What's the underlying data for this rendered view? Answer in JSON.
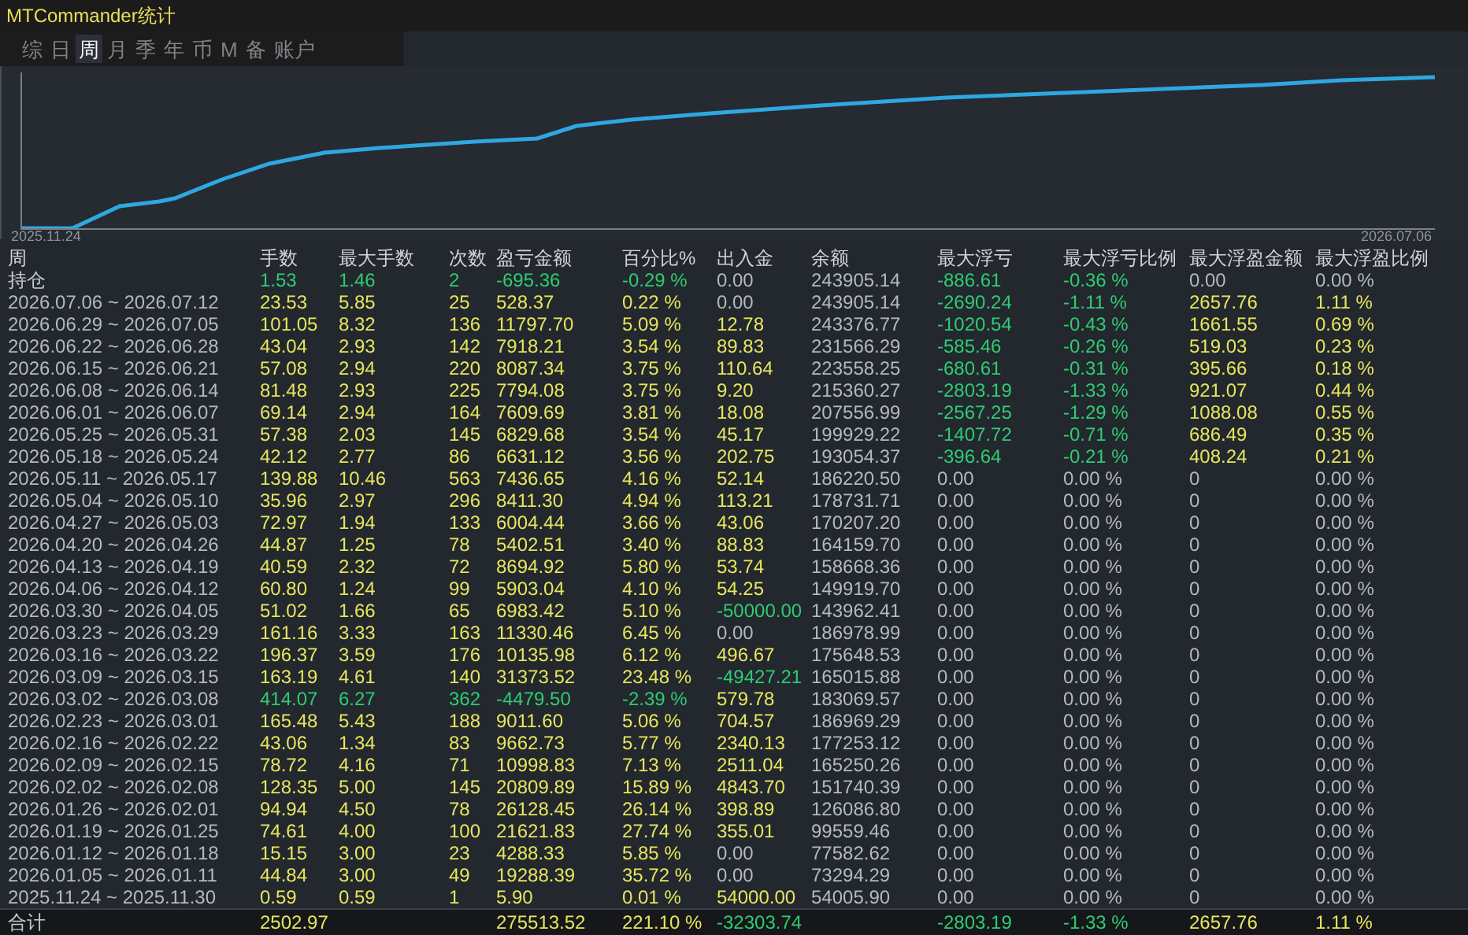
{
  "window": {
    "title": "MTCommander统计"
  },
  "tabs": [
    {
      "label": "综",
      "selected": false
    },
    {
      "label": "日",
      "selected": false
    },
    {
      "label": "周",
      "selected": true
    },
    {
      "label": "月",
      "selected": false
    },
    {
      "label": "季",
      "selected": false
    },
    {
      "label": "年",
      "selected": false
    },
    {
      "label": "币",
      "selected": false
    },
    {
      "label": "M",
      "selected": false
    },
    {
      "label": "备",
      "selected": false
    },
    {
      "label": "账户",
      "selected": false
    }
  ],
  "chart": {
    "start_label": "2025.11.24",
    "end_label": "2026.07.06"
  },
  "table": {
    "columns": [
      "周",
      "手数",
      "最大手数",
      "次数",
      "盈亏金额",
      "百分比%",
      "出入金",
      "余额",
      "最大浮亏",
      "最大浮亏比例",
      "最大浮盈金额",
      "最大浮盈比例"
    ],
    "rows": [
      [
        {
          "text": "持仓",
          "color": "#c4c8cf"
        },
        {
          "text": "1.53",
          "color": "#2ecc71"
        },
        {
          "text": "1.46",
          "color": "#2ecc71"
        },
        {
          "text": "2",
          "color": "#2ecc71"
        },
        {
          "text": "-695.36",
          "color": "#2ecc71"
        },
        {
          "text": "-0.29 %",
          "color": "#2ecc71"
        },
        {
          "text": "0.00",
          "color": "#b4b9c2"
        },
        {
          "text": "243905.14",
          "color": "#b4b9c2"
        },
        {
          "text": "-886.61",
          "color": "#2ecc71"
        },
        {
          "text": "-0.36 %",
          "color": "#2ecc71"
        },
        {
          "text": "0.00",
          "color": "#b4b9c2"
        },
        {
          "text": "0.00 %",
          "color": "#b4b9c2"
        }
      ],
      [
        {
          "text": "2026.07.06 ~ 2026.07.12",
          "color": "#b4b9c2"
        },
        {
          "text": "23.53",
          "color": "#e6e65c"
        },
        {
          "text": "5.85",
          "color": "#e6e65c"
        },
        {
          "text": "25",
          "color": "#e6e65c"
        },
        {
          "text": "528.37",
          "color": "#e6e65c"
        },
        {
          "text": "0.22 %",
          "color": "#e6e65c"
        },
        {
          "text": "0.00",
          "color": "#b4b9c2"
        },
        {
          "text": "243905.14",
          "color": "#b4b9c2"
        },
        {
          "text": "-2690.24",
          "color": "#2ecc71"
        },
        {
          "text": "-1.11 %",
          "color": "#2ecc71"
        },
        {
          "text": "2657.76",
          "color": "#e6e65c"
        },
        {
          "text": "1.11 %",
          "color": "#e6e65c"
        }
      ],
      [
        {
          "text": "2026.06.29 ~ 2026.07.05",
          "color": "#b4b9c2"
        },
        {
          "text": "101.05",
          "color": "#e6e65c"
        },
        {
          "text": "8.32",
          "color": "#e6e65c"
        },
        {
          "text": "136",
          "color": "#e6e65c"
        },
        {
          "text": "11797.70",
          "color": "#e6e65c"
        },
        {
          "text": "5.09 %",
          "color": "#e6e65c"
        },
        {
          "text": "12.78",
          "color": "#e6e65c"
        },
        {
          "text": "243376.77",
          "color": "#b4b9c2"
        },
        {
          "text": "-1020.54",
          "color": "#2ecc71"
        },
        {
          "text": "-0.43 %",
          "color": "#2ecc71"
        },
        {
          "text": "1661.55",
          "color": "#e6e65c"
        },
        {
          "text": "0.69 %",
          "color": "#e6e65c"
        }
      ],
      [
        {
          "text": "2026.06.22 ~ 2026.06.28",
          "color": "#b4b9c2"
        },
        {
          "text": "43.04",
          "color": "#e6e65c"
        },
        {
          "text": "2.93",
          "color": "#e6e65c"
        },
        {
          "text": "142",
          "color": "#e6e65c"
        },
        {
          "text": "7918.21",
          "color": "#e6e65c"
        },
        {
          "text": "3.54 %",
          "color": "#e6e65c"
        },
        {
          "text": "89.83",
          "color": "#e6e65c"
        },
        {
          "text": "231566.29",
          "color": "#b4b9c2"
        },
        {
          "text": "-585.46",
          "color": "#2ecc71"
        },
        {
          "text": "-0.26 %",
          "color": "#2ecc71"
        },
        {
          "text": "519.03",
          "color": "#e6e65c"
        },
        {
          "text": "0.23 %",
          "color": "#e6e65c"
        }
      ],
      [
        {
          "text": "2026.06.15 ~ 2026.06.21",
          "color": "#b4b9c2"
        },
        {
          "text": "57.08",
          "color": "#e6e65c"
        },
        {
          "text": "2.94",
          "color": "#e6e65c"
        },
        {
          "text": "220",
          "color": "#e6e65c"
        },
        {
          "text": "8087.34",
          "color": "#e6e65c"
        },
        {
          "text": "3.75 %",
          "color": "#e6e65c"
        },
        {
          "text": "110.64",
          "color": "#e6e65c"
        },
        {
          "text": "223558.25",
          "color": "#b4b9c2"
        },
        {
          "text": "-680.61",
          "color": "#2ecc71"
        },
        {
          "text": "-0.31 %",
          "color": "#2ecc71"
        },
        {
          "text": "395.66",
          "color": "#e6e65c"
        },
        {
          "text": "0.18 %",
          "color": "#e6e65c"
        }
      ],
      [
        {
          "text": "2026.06.08 ~ 2026.06.14",
          "color": "#b4b9c2"
        },
        {
          "text": "81.48",
          "color": "#e6e65c"
        },
        {
          "text": "2.93",
          "color": "#e6e65c"
        },
        {
          "text": "225",
          "color": "#e6e65c"
        },
        {
          "text": "7794.08",
          "color": "#e6e65c"
        },
        {
          "text": "3.75 %",
          "color": "#e6e65c"
        },
        {
          "text": "9.20",
          "color": "#e6e65c"
        },
        {
          "text": "215360.27",
          "color": "#b4b9c2"
        },
        {
          "text": "-2803.19",
          "color": "#2ecc71"
        },
        {
          "text": "-1.33 %",
          "color": "#2ecc71"
        },
        {
          "text": "921.07",
          "color": "#e6e65c"
        },
        {
          "text": "0.44 %",
          "color": "#e6e65c"
        }
      ],
      [
        {
          "text": "2026.06.01 ~ 2026.06.07",
          "color": "#b4b9c2"
        },
        {
          "text": "69.14",
          "color": "#e6e65c"
        },
        {
          "text": "2.94",
          "color": "#e6e65c"
        },
        {
          "text": "164",
          "color": "#e6e65c"
        },
        {
          "text": "7609.69",
          "color": "#e6e65c"
        },
        {
          "text": "3.81 %",
          "color": "#e6e65c"
        },
        {
          "text": "18.08",
          "color": "#e6e65c"
        },
        {
          "text": "207556.99",
          "color": "#b4b9c2"
        },
        {
          "text": "-2567.25",
          "color": "#2ecc71"
        },
        {
          "text": "-1.29 %",
          "color": "#2ecc71"
        },
        {
          "text": "1088.08",
          "color": "#e6e65c"
        },
        {
          "text": "0.55 %",
          "color": "#e6e65c"
        }
      ],
      [
        {
          "text": "2026.05.25 ~ 2026.05.31",
          "color": "#b4b9c2"
        },
        {
          "text": "57.38",
          "color": "#e6e65c"
        },
        {
          "text": "2.03",
          "color": "#e6e65c"
        },
        {
          "text": "145",
          "color": "#e6e65c"
        },
        {
          "text": "6829.68",
          "color": "#e6e65c"
        },
        {
          "text": "3.54 %",
          "color": "#e6e65c"
        },
        {
          "text": "45.17",
          "color": "#e6e65c"
        },
        {
          "text": "199929.22",
          "color": "#b4b9c2"
        },
        {
          "text": "-1407.72",
          "color": "#2ecc71"
        },
        {
          "text": "-0.71 %",
          "color": "#2ecc71"
        },
        {
          "text": "686.49",
          "color": "#e6e65c"
        },
        {
          "text": "0.35 %",
          "color": "#e6e65c"
        }
      ],
      [
        {
          "text": "2026.05.18 ~ 2026.05.24",
          "color": "#b4b9c2"
        },
        {
          "text": "42.12",
          "color": "#e6e65c"
        },
        {
          "text": "2.77",
          "color": "#e6e65c"
        },
        {
          "text": "86",
          "color": "#e6e65c"
        },
        {
          "text": "6631.12",
          "color": "#e6e65c"
        },
        {
          "text": "3.56 %",
          "color": "#e6e65c"
        },
        {
          "text": "202.75",
          "color": "#e6e65c"
        },
        {
          "text": "193054.37",
          "color": "#b4b9c2"
        },
        {
          "text": "-396.64",
          "color": "#2ecc71"
        },
        {
          "text": "-0.21 %",
          "color": "#2ecc71"
        },
        {
          "text": "408.24",
          "color": "#e6e65c"
        },
        {
          "text": "0.21 %",
          "color": "#e6e65c"
        }
      ],
      [
        {
          "text": "2026.05.11 ~ 2026.05.17",
          "color": "#b4b9c2"
        },
        {
          "text": "139.88",
          "color": "#e6e65c"
        },
        {
          "text": "10.46",
          "color": "#e6e65c"
        },
        {
          "text": "563",
          "color": "#e6e65c"
        },
        {
          "text": "7436.65",
          "color": "#e6e65c"
        },
        {
          "text": "4.16 %",
          "color": "#e6e65c"
        },
        {
          "text": "52.14",
          "color": "#e6e65c"
        },
        {
          "text": "186220.50",
          "color": "#b4b9c2"
        },
        {
          "text": "0.00",
          "color": "#b4b9c2"
        },
        {
          "text": "0.00 %",
          "color": "#b4b9c2"
        },
        {
          "text": "0",
          "color": "#b4b9c2"
        },
        {
          "text": "0.00 %",
          "color": "#b4b9c2"
        }
      ],
      [
        {
          "text": "2026.05.04 ~ 2026.05.10",
          "color": "#b4b9c2"
        },
        {
          "text": "35.96",
          "color": "#e6e65c"
        },
        {
          "text": "2.97",
          "color": "#e6e65c"
        },
        {
          "text": "296",
          "color": "#e6e65c"
        },
        {
          "text": "8411.30",
          "color": "#e6e65c"
        },
        {
          "text": "4.94 %",
          "color": "#e6e65c"
        },
        {
          "text": "113.21",
          "color": "#e6e65c"
        },
        {
          "text": "178731.71",
          "color": "#b4b9c2"
        },
        {
          "text": "0.00",
          "color": "#b4b9c2"
        },
        {
          "text": "0.00 %",
          "color": "#b4b9c2"
        },
        {
          "text": "0",
          "color": "#b4b9c2"
        },
        {
          "text": "0.00 %",
          "color": "#b4b9c2"
        }
      ],
      [
        {
          "text": "2026.04.27 ~ 2026.05.03",
          "color": "#b4b9c2"
        },
        {
          "text": "72.97",
          "color": "#e6e65c"
        },
        {
          "text": "1.94",
          "color": "#e6e65c"
        },
        {
          "text": "133",
          "color": "#e6e65c"
        },
        {
          "text": "6004.44",
          "color": "#e6e65c"
        },
        {
          "text": "3.66 %",
          "color": "#e6e65c"
        },
        {
          "text": "43.06",
          "color": "#e6e65c"
        },
        {
          "text": "170207.20",
          "color": "#b4b9c2"
        },
        {
          "text": "0.00",
          "color": "#b4b9c2"
        },
        {
          "text": "0.00 %",
          "color": "#b4b9c2"
        },
        {
          "text": "0",
          "color": "#b4b9c2"
        },
        {
          "text": "0.00 %",
          "color": "#b4b9c2"
        }
      ],
      [
        {
          "text": "2026.04.20 ~ 2026.04.26",
          "color": "#b4b9c2"
        },
        {
          "text": "44.87",
          "color": "#e6e65c"
        },
        {
          "text": "1.25",
          "color": "#e6e65c"
        },
        {
          "text": "78",
          "color": "#e6e65c"
        },
        {
          "text": "5402.51",
          "color": "#e6e65c"
        },
        {
          "text": "3.40 %",
          "color": "#e6e65c"
        },
        {
          "text": "88.83",
          "color": "#e6e65c"
        },
        {
          "text": "164159.70",
          "color": "#b4b9c2"
        },
        {
          "text": "0.00",
          "color": "#b4b9c2"
        },
        {
          "text": "0.00 %",
          "color": "#b4b9c2"
        },
        {
          "text": "0",
          "color": "#b4b9c2"
        },
        {
          "text": "0.00 %",
          "color": "#b4b9c2"
        }
      ],
      [
        {
          "text": "2026.04.13 ~ 2026.04.19",
          "color": "#b4b9c2"
        },
        {
          "text": "40.59",
          "color": "#e6e65c"
        },
        {
          "text": "2.32",
          "color": "#e6e65c"
        },
        {
          "text": "72",
          "color": "#e6e65c"
        },
        {
          "text": "8694.92",
          "color": "#e6e65c"
        },
        {
          "text": "5.80 %",
          "color": "#e6e65c"
        },
        {
          "text": "53.74",
          "color": "#e6e65c"
        },
        {
          "text": "158668.36",
          "color": "#b4b9c2"
        },
        {
          "text": "0.00",
          "color": "#b4b9c2"
        },
        {
          "text": "0.00 %",
          "color": "#b4b9c2"
        },
        {
          "text": "0",
          "color": "#b4b9c2"
        },
        {
          "text": "0.00 %",
          "color": "#b4b9c2"
        }
      ],
      [
        {
          "text": "2026.04.06 ~ 2026.04.12",
          "color": "#b4b9c2"
        },
        {
          "text": "60.80",
          "color": "#e6e65c"
        },
        {
          "text": "1.24",
          "color": "#e6e65c"
        },
        {
          "text": "99",
          "color": "#e6e65c"
        },
        {
          "text": "5903.04",
          "color": "#e6e65c"
        },
        {
          "text": "4.10 %",
          "color": "#e6e65c"
        },
        {
          "text": "54.25",
          "color": "#e6e65c"
        },
        {
          "text": "149919.70",
          "color": "#b4b9c2"
        },
        {
          "text": "0.00",
          "color": "#b4b9c2"
        },
        {
          "text": "0.00 %",
          "color": "#b4b9c2"
        },
        {
          "text": "0",
          "color": "#b4b9c2"
        },
        {
          "text": "0.00 %",
          "color": "#b4b9c2"
        }
      ],
      [
        {
          "text": "2026.03.30 ~ 2026.04.05",
          "color": "#b4b9c2"
        },
        {
          "text": "51.02",
          "color": "#e6e65c"
        },
        {
          "text": "1.66",
          "color": "#e6e65c"
        },
        {
          "text": "65",
          "color": "#e6e65c"
        },
        {
          "text": "6983.42",
          "color": "#e6e65c"
        },
        {
          "text": "5.10 %",
          "color": "#e6e65c"
        },
        {
          "text": "-50000.00",
          "color": "#2ecc71"
        },
        {
          "text": "143962.41",
          "color": "#b4b9c2"
        },
        {
          "text": "0.00",
          "color": "#b4b9c2"
        },
        {
          "text": "0.00 %",
          "color": "#b4b9c2"
        },
        {
          "text": "0",
          "color": "#b4b9c2"
        },
        {
          "text": "0.00 %",
          "color": "#b4b9c2"
        }
      ],
      [
        {
          "text": "2026.03.23 ~ 2026.03.29",
          "color": "#b4b9c2"
        },
        {
          "text": "161.16",
          "color": "#e6e65c"
        },
        {
          "text": "3.33",
          "color": "#e6e65c"
        },
        {
          "text": "163",
          "color": "#e6e65c"
        },
        {
          "text": "11330.46",
          "color": "#e6e65c"
        },
        {
          "text": "6.45 %",
          "color": "#e6e65c"
        },
        {
          "text": "0.00",
          "color": "#b4b9c2"
        },
        {
          "text": "186978.99",
          "color": "#b4b9c2"
        },
        {
          "text": "0.00",
          "color": "#b4b9c2"
        },
        {
          "text": "0.00 %",
          "color": "#b4b9c2"
        },
        {
          "text": "0",
          "color": "#b4b9c2"
        },
        {
          "text": "0.00 %",
          "color": "#b4b9c2"
        }
      ],
      [
        {
          "text": "2026.03.16 ~ 2026.03.22",
          "color": "#b4b9c2"
        },
        {
          "text": "196.37",
          "color": "#e6e65c"
        },
        {
          "text": "3.59",
          "color": "#e6e65c"
        },
        {
          "text": "176",
          "color": "#e6e65c"
        },
        {
          "text": "10135.98",
          "color": "#e6e65c"
        },
        {
          "text": "6.12 %",
          "color": "#e6e65c"
        },
        {
          "text": "496.67",
          "color": "#e6e65c"
        },
        {
          "text": "175648.53",
          "color": "#b4b9c2"
        },
        {
          "text": "0.00",
          "color": "#b4b9c2"
        },
        {
          "text": "0.00 %",
          "color": "#b4b9c2"
        },
        {
          "text": "0",
          "color": "#b4b9c2"
        },
        {
          "text": "0.00 %",
          "color": "#b4b9c2"
        }
      ],
      [
        {
          "text": "2026.03.09 ~ 2026.03.15",
          "color": "#b4b9c2"
        },
        {
          "text": "163.19",
          "color": "#e6e65c"
        },
        {
          "text": "4.61",
          "color": "#e6e65c"
        },
        {
          "text": "140",
          "color": "#e6e65c"
        },
        {
          "text": "31373.52",
          "color": "#e6e65c"
        },
        {
          "text": "23.48 %",
          "color": "#e6e65c"
        },
        {
          "text": "-49427.21",
          "color": "#2ecc71"
        },
        {
          "text": "165015.88",
          "color": "#b4b9c2"
        },
        {
          "text": "0.00",
          "color": "#b4b9c2"
        },
        {
          "text": "0.00 %",
          "color": "#b4b9c2"
        },
        {
          "text": "0",
          "color": "#b4b9c2"
        },
        {
          "text": "0.00 %",
          "color": "#b4b9c2"
        }
      ],
      [
        {
          "text": "2026.03.02 ~ 2026.03.08",
          "color": "#b4b9c2"
        },
        {
          "text": "414.07",
          "color": "#2ecc71"
        },
        {
          "text": "6.27",
          "color": "#2ecc71"
        },
        {
          "text": "362",
          "color": "#2ecc71"
        },
        {
          "text": "-4479.50",
          "color": "#2ecc71"
        },
        {
          "text": "-2.39 %",
          "color": "#2ecc71"
        },
        {
          "text": "579.78",
          "color": "#e6e65c"
        },
        {
          "text": "183069.57",
          "color": "#b4b9c2"
        },
        {
          "text": "0.00",
          "color": "#b4b9c2"
        },
        {
          "text": "0.00 %",
          "color": "#b4b9c2"
        },
        {
          "text": "0",
          "color": "#b4b9c2"
        },
        {
          "text": "0.00 %",
          "color": "#b4b9c2"
        }
      ],
      [
        {
          "text": "2026.02.23 ~ 2026.03.01",
          "color": "#b4b9c2"
        },
        {
          "text": "165.48",
          "color": "#e6e65c"
        },
        {
          "text": "5.43",
          "color": "#e6e65c"
        },
        {
          "text": "188",
          "color": "#e6e65c"
        },
        {
          "text": "9011.60",
          "color": "#e6e65c"
        },
        {
          "text": "5.06 %",
          "color": "#e6e65c"
        },
        {
          "text": "704.57",
          "color": "#e6e65c"
        },
        {
          "text": "186969.29",
          "color": "#b4b9c2"
        },
        {
          "text": "0.00",
          "color": "#b4b9c2"
        },
        {
          "text": "0.00 %",
          "color": "#b4b9c2"
        },
        {
          "text": "0",
          "color": "#b4b9c2"
        },
        {
          "text": "0.00 %",
          "color": "#b4b9c2"
        }
      ],
      [
        {
          "text": "2026.02.16 ~ 2026.02.22",
          "color": "#b4b9c2"
        },
        {
          "text": "43.06",
          "color": "#e6e65c"
        },
        {
          "text": "1.34",
          "color": "#e6e65c"
        },
        {
          "text": "83",
          "color": "#e6e65c"
        },
        {
          "text": "9662.73",
          "color": "#e6e65c"
        },
        {
          "text": "5.77 %",
          "color": "#e6e65c"
        },
        {
          "text": "2340.13",
          "color": "#e6e65c"
        },
        {
          "text": "177253.12",
          "color": "#b4b9c2"
        },
        {
          "text": "0.00",
          "color": "#b4b9c2"
        },
        {
          "text": "0.00 %",
          "color": "#b4b9c2"
        },
        {
          "text": "0",
          "color": "#b4b9c2"
        },
        {
          "text": "0.00 %",
          "color": "#b4b9c2"
        }
      ],
      [
        {
          "text": "2026.02.09 ~ 2026.02.15",
          "color": "#b4b9c2"
        },
        {
          "text": "78.72",
          "color": "#e6e65c"
        },
        {
          "text": "4.16",
          "color": "#e6e65c"
        },
        {
          "text": "71",
          "color": "#e6e65c"
        },
        {
          "text": "10998.83",
          "color": "#e6e65c"
        },
        {
          "text": "7.13 %",
          "color": "#e6e65c"
        },
        {
          "text": "2511.04",
          "color": "#e6e65c"
        },
        {
          "text": "165250.26",
          "color": "#b4b9c2"
        },
        {
          "text": "0.00",
          "color": "#b4b9c2"
        },
        {
          "text": "0.00 %",
          "color": "#b4b9c2"
        },
        {
          "text": "0",
          "color": "#b4b9c2"
        },
        {
          "text": "0.00 %",
          "color": "#b4b9c2"
        }
      ],
      [
        {
          "text": "2026.02.02 ~ 2026.02.08",
          "color": "#b4b9c2"
        },
        {
          "text": "128.35",
          "color": "#e6e65c"
        },
        {
          "text": "5.00",
          "color": "#e6e65c"
        },
        {
          "text": "145",
          "color": "#e6e65c"
        },
        {
          "text": "20809.89",
          "color": "#e6e65c"
        },
        {
          "text": "15.89 %",
          "color": "#e6e65c"
        },
        {
          "text": "4843.70",
          "color": "#e6e65c"
        },
        {
          "text": "151740.39",
          "color": "#b4b9c2"
        },
        {
          "text": "0.00",
          "color": "#b4b9c2"
        },
        {
          "text": "0.00 %",
          "color": "#b4b9c2"
        },
        {
          "text": "0",
          "color": "#b4b9c2"
        },
        {
          "text": "0.00 %",
          "color": "#b4b9c2"
        }
      ],
      [
        {
          "text": "2026.01.26 ~ 2026.02.01",
          "color": "#b4b9c2"
        },
        {
          "text": "94.94",
          "color": "#e6e65c"
        },
        {
          "text": "4.50",
          "color": "#e6e65c"
        },
        {
          "text": "78",
          "color": "#e6e65c"
        },
        {
          "text": "26128.45",
          "color": "#e6e65c"
        },
        {
          "text": "26.14 %",
          "color": "#e6e65c"
        },
        {
          "text": "398.89",
          "color": "#e6e65c"
        },
        {
          "text": "126086.80",
          "color": "#b4b9c2"
        },
        {
          "text": "0.00",
          "color": "#b4b9c2"
        },
        {
          "text": "0.00 %",
          "color": "#b4b9c2"
        },
        {
          "text": "0",
          "color": "#b4b9c2"
        },
        {
          "text": "0.00 %",
          "color": "#b4b9c2"
        }
      ],
      [
        {
          "text": "2026.01.19 ~ 2026.01.25",
          "color": "#b4b9c2"
        },
        {
          "text": "74.61",
          "color": "#e6e65c"
        },
        {
          "text": "4.00",
          "color": "#e6e65c"
        },
        {
          "text": "100",
          "color": "#e6e65c"
        },
        {
          "text": "21621.83",
          "color": "#e6e65c"
        },
        {
          "text": "27.74 %",
          "color": "#e6e65c"
        },
        {
          "text": "355.01",
          "color": "#e6e65c"
        },
        {
          "text": "99559.46",
          "color": "#b4b9c2"
        },
        {
          "text": "0.00",
          "color": "#b4b9c2"
        },
        {
          "text": "0.00 %",
          "color": "#b4b9c2"
        },
        {
          "text": "0",
          "color": "#b4b9c2"
        },
        {
          "text": "0.00 %",
          "color": "#b4b9c2"
        }
      ],
      [
        {
          "text": "2026.01.12 ~ 2026.01.18",
          "color": "#b4b9c2"
        },
        {
          "text": "15.15",
          "color": "#e6e65c"
        },
        {
          "text": "3.00",
          "color": "#e6e65c"
        },
        {
          "text": "23",
          "color": "#e6e65c"
        },
        {
          "text": "4288.33",
          "color": "#e6e65c"
        },
        {
          "text": "5.85 %",
          "color": "#e6e65c"
        },
        {
          "text": "0.00",
          "color": "#b4b9c2"
        },
        {
          "text": "77582.62",
          "color": "#b4b9c2"
        },
        {
          "text": "0.00",
          "color": "#b4b9c2"
        },
        {
          "text": "0.00 %",
          "color": "#b4b9c2"
        },
        {
          "text": "0",
          "color": "#b4b9c2"
        },
        {
          "text": "0.00 %",
          "color": "#b4b9c2"
        }
      ],
      [
        {
          "text": "2026.01.05 ~ 2026.01.11",
          "color": "#b4b9c2"
        },
        {
          "text": "44.84",
          "color": "#e6e65c"
        },
        {
          "text": "3.00",
          "color": "#e6e65c"
        },
        {
          "text": "49",
          "color": "#e6e65c"
        },
        {
          "text": "19288.39",
          "color": "#e6e65c"
        },
        {
          "text": "35.72 %",
          "color": "#e6e65c"
        },
        {
          "text": "0.00",
          "color": "#b4b9c2"
        },
        {
          "text": "73294.29",
          "color": "#b4b9c2"
        },
        {
          "text": "0.00",
          "color": "#b4b9c2"
        },
        {
          "text": "0.00 %",
          "color": "#b4b9c2"
        },
        {
          "text": "0",
          "color": "#b4b9c2"
        },
        {
          "text": "0.00 %",
          "color": "#b4b9c2"
        }
      ],
      [
        {
          "text": "2025.11.24 ~ 2025.11.30",
          "color": "#b4b9c2"
        },
        {
          "text": "0.59",
          "color": "#e6e65c"
        },
        {
          "text": "0.59",
          "color": "#e6e65c"
        },
        {
          "text": "1",
          "color": "#e6e65c"
        },
        {
          "text": "5.90",
          "color": "#e6e65c"
        },
        {
          "text": "0.01 %",
          "color": "#e6e65c"
        },
        {
          "text": "54000.00",
          "color": "#e6e65c"
        },
        {
          "text": "54005.90",
          "color": "#b4b9c2"
        },
        {
          "text": "0.00",
          "color": "#b4b9c2"
        },
        {
          "text": "0.00 %",
          "color": "#b4b9c2"
        },
        {
          "text": "0",
          "color": "#b4b9c2"
        },
        {
          "text": "0.00 %",
          "color": "#b4b9c2"
        }
      ]
    ],
    "total": {
      "label": {
        "text": "合计",
        "color": "#c4c8cf"
      },
      "lots": {
        "text": "2502.97",
        "color": "#e6e65c"
      },
      "pnl": {
        "text": "275513.52",
        "color": "#e6e65c"
      },
      "pct": {
        "text": "221.10 %",
        "color": "#e6e65c"
      },
      "in_out": {
        "text": "-32303.74",
        "color": "#2ecc71"
      },
      "max_loss": {
        "text": "-2803.19",
        "color": "#2ecc71"
      },
      "max_loss_ratio": {
        "text": "-1.33 %",
        "color": "#2ecc71"
      },
      "max_profit": {
        "text": "2657.76",
        "color": "#e6e65c"
      },
      "max_profit_ratio": {
        "text": "1.11 %",
        "color": "#e6e65c"
      }
    }
  }
}
